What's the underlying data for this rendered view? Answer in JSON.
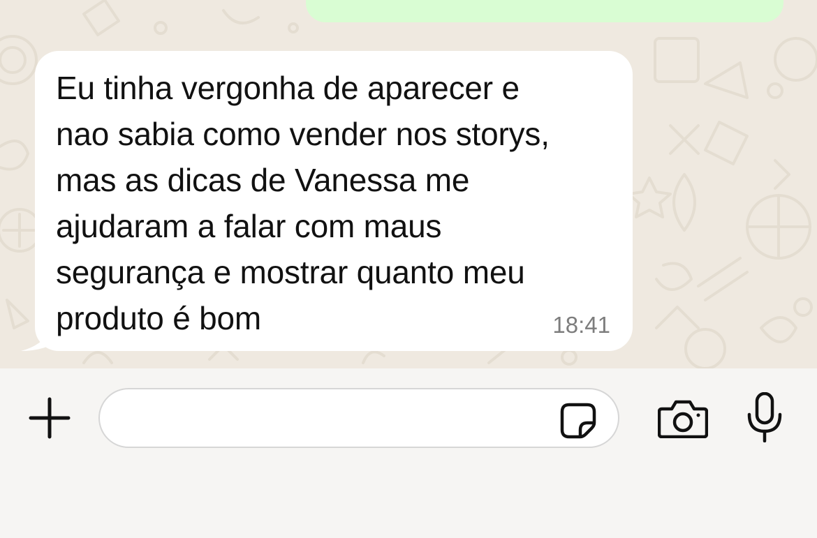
{
  "chat": {
    "received_message": {
      "text": "Eu tinha vergonha de aparecer e\nnao sabia como vender nos storys,\nmas as dicas de Vanessa me\najudaram a falar com maus\nsegurança e mostrar quanto meu\nproduto é bom",
      "time": "18:41"
    },
    "colors": {
      "wallpaper": "#efe9e0",
      "received_bubble": "#ffffff",
      "sent_bubble": "#d9fdd3"
    }
  },
  "composer": {
    "input_value": "",
    "input_placeholder": "",
    "icons": {
      "attach": "plus-icon",
      "sticker": "sticker-icon",
      "camera": "camera-icon",
      "voice": "microphone-icon"
    }
  }
}
